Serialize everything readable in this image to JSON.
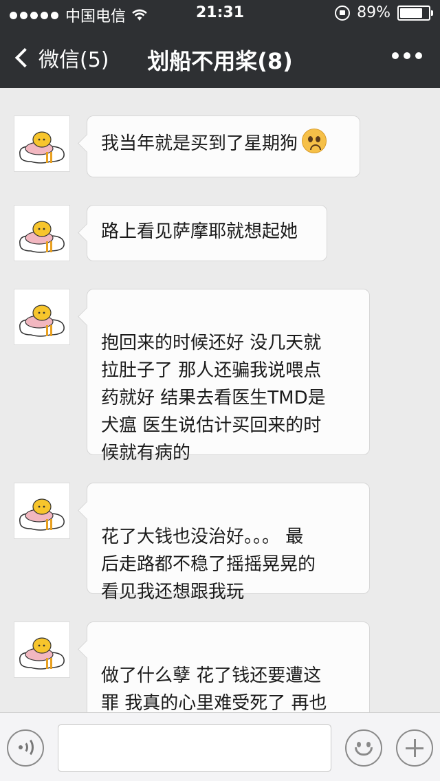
{
  "status_bar": {
    "carrier": "中国电信",
    "time": "21:31",
    "battery_percent": "89%",
    "battery_level": 0.89
  },
  "nav": {
    "back_label": "微信(5)",
    "title": "划船不用桨(8)"
  },
  "messages": [
    {
      "text": "我当年就是买到了星期狗",
      "emoji": "sad-face-emoji"
    },
    {
      "text": "路上看见萨摩耶就想起她"
    },
    {
      "text": "抱回来的时候还好 没几天就\n拉肚子了 那人还骗我说喂点\n药就好 结果去看医生TMD是\n犬瘟 医生说估计买回来的时\n候就有病的"
    },
    {
      "text": "花了大钱也没治好。。。 最\n后走路都不稳了摇摇晃晃的\n看见我还想跟我玩"
    },
    {
      "text": "做了什么孽 花了钱还要遭这\n罪 我真的心里难受死了 再也\n不敢养狗了"
    }
  ],
  "input_bar": {
    "placeholder": "",
    "icons": [
      "voice-icon",
      "emoji-icon",
      "plus-icon"
    ]
  },
  "colors": {
    "header_bg": "#2e3033",
    "chat_bg": "#ebebeb",
    "bubble_bg": "#fcfcfc"
  }
}
